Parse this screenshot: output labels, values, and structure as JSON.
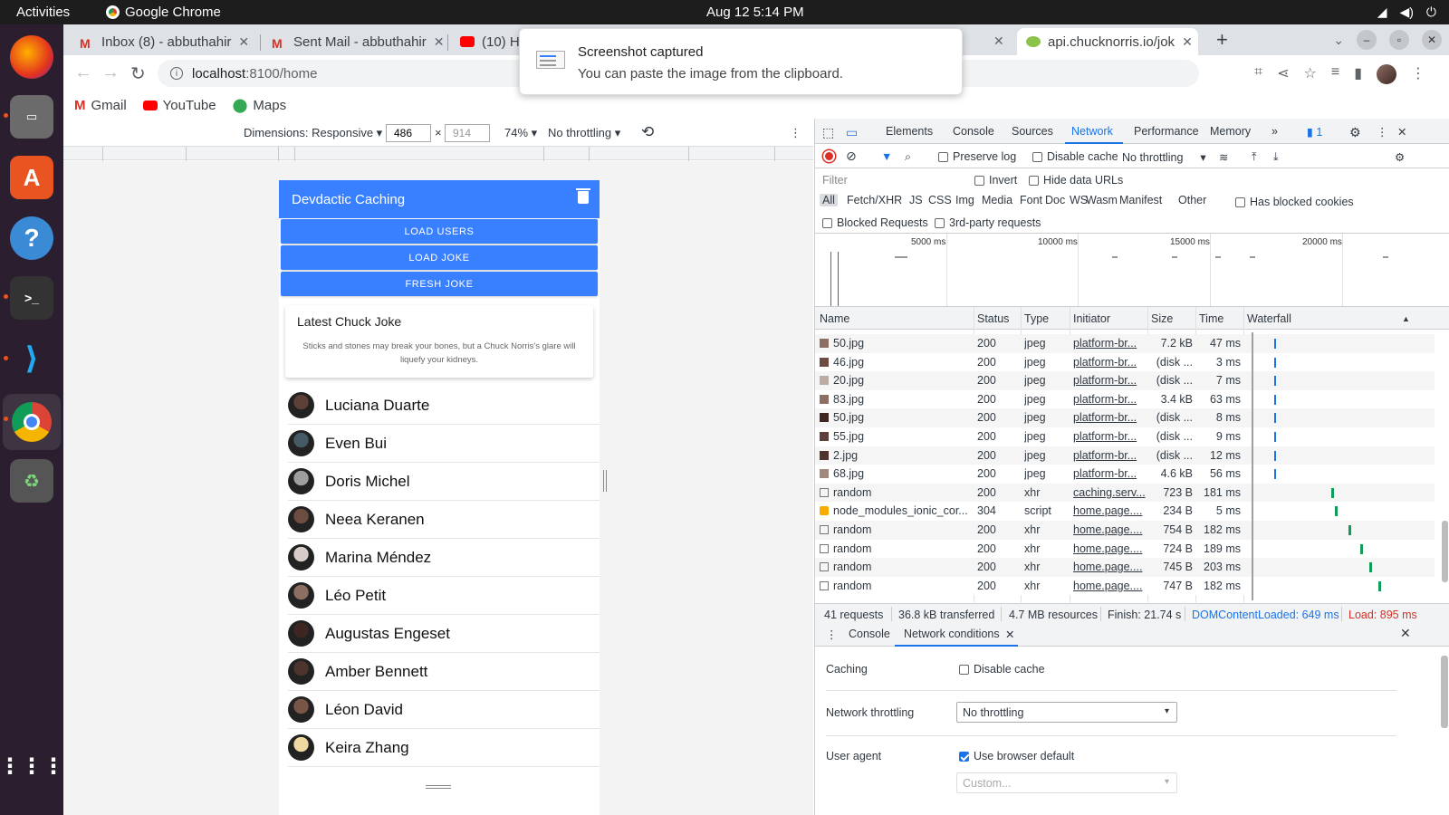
{
  "topbar": {
    "activities": "Activities",
    "app_name": "Google Chrome",
    "clock": "Aug 12  5:14 PM"
  },
  "tabs": [
    {
      "label": "Inbox (8) - abbuthahir",
      "fav": "gmail"
    },
    {
      "label": "Sent Mail - abbuthahir",
      "fav": "gmail"
    },
    {
      "label": "(10) He",
      "fav": "youtube"
    },
    {
      "label": "api.chucknorris.io/jok",
      "fav": "chuck"
    }
  ],
  "omnibox": {
    "host": "localhost",
    "path": ":8100/home"
  },
  "bookmarks": [
    {
      "label": "Gmail",
      "icon": "gmail-icon"
    },
    {
      "label": "YouTube",
      "icon": "youtube-icon"
    },
    {
      "label": "Maps",
      "icon": "maps-icon"
    }
  ],
  "device_bar": {
    "dimensions": "Dimensions: Responsive ▾",
    "width": "486",
    "height": "914",
    "zoom": "74% ▾",
    "throttle": "No throttling ▾"
  },
  "notification": {
    "title": "Screenshot captured",
    "body": "You can paste the image from the clipboard."
  },
  "app": {
    "title": "Devdactic Caching",
    "buttons": [
      "LOAD USERS",
      "LOAD JOKE",
      "FRESH JOKE"
    ],
    "joke_title": "Latest Chuck Joke",
    "joke_text": "Sticks and stones may break your bones, but a Chuck Norris's glare will liquefy your kidneys.",
    "users": [
      {
        "name": "Luciana Duarte",
        "color": "#5d4037"
      },
      {
        "name": "Even Bui",
        "color": "#455a64"
      },
      {
        "name": "Doris Michel",
        "color": "#9e9e9e"
      },
      {
        "name": "Neea Keranen",
        "color": "#6d4c41"
      },
      {
        "name": "Marina Méndez",
        "color": "#d7ccc8"
      },
      {
        "name": "Léo Petit",
        "color": "#8d6e63"
      },
      {
        "name": "Augustas Engeset",
        "color": "#3e2723"
      },
      {
        "name": "Amber Bennett",
        "color": "#4e342e"
      },
      {
        "name": "Léon David",
        "color": "#795548"
      },
      {
        "name": "Keira Zhang",
        "color": "#f0d9a0"
      }
    ]
  },
  "devtools": {
    "tabs": [
      "Elements",
      "Console",
      "Sources",
      "Network",
      "Performance",
      "Memory"
    ],
    "badge": "1",
    "toolbar": {
      "preserve_log": "Preserve log",
      "disable_cache": "Disable cache",
      "throttling": "No throttling"
    },
    "filter_placeholder": "Filter",
    "invert": "Invert",
    "hide_data_urls": "Hide data URLs",
    "type_filters": [
      "All",
      "Fetch/XHR",
      "JS",
      "CSS",
      "Img",
      "Media",
      "Font",
      "Doc",
      "WS",
      "Wasm",
      "Manifest",
      "Other"
    ],
    "has_blocked_cookies": "Has blocked cookies",
    "blocked_requests": "Blocked Requests",
    "third_party": "3rd-party requests",
    "overview_ticks": [
      "5000 ms",
      "10000 ms",
      "15000 ms",
      "20000 ms"
    ],
    "columns": [
      "Name",
      "Status",
      "Type",
      "Initiator",
      "Size",
      "Time",
      "Waterfall"
    ],
    "rows": [
      {
        "name": "50.jpg",
        "status": "200",
        "type": "jpeg",
        "initiator": "platform-br...",
        "size": "7.2 kB",
        "time": "47 ms",
        "icon": "#8d6e63"
      },
      {
        "name": "46.jpg",
        "status": "200",
        "type": "jpeg",
        "initiator": "platform-br...",
        "size": "(disk ...",
        "time": "3 ms",
        "icon": "#6d4c41"
      },
      {
        "name": "20.jpg",
        "status": "200",
        "type": "jpeg",
        "initiator": "platform-br...",
        "size": "(disk ...",
        "time": "7 ms",
        "icon": "#bcaaa4"
      },
      {
        "name": "83.jpg",
        "status": "200",
        "type": "jpeg",
        "initiator": "platform-br...",
        "size": "3.4 kB",
        "time": "63 ms",
        "icon": "#8d6e63"
      },
      {
        "name": "50.jpg",
        "status": "200",
        "type": "jpeg",
        "initiator": "platform-br...",
        "size": "(disk ...",
        "time": "8 ms",
        "icon": "#3e2723"
      },
      {
        "name": "55.jpg",
        "status": "200",
        "type": "jpeg",
        "initiator": "platform-br...",
        "size": "(disk ...",
        "time": "9 ms",
        "icon": "#5d4037"
      },
      {
        "name": "2.jpg",
        "status": "200",
        "type": "jpeg",
        "initiator": "platform-br...",
        "size": "(disk ...",
        "time": "12 ms",
        "icon": "#4e342e"
      },
      {
        "name": "68.jpg",
        "status": "200",
        "type": "jpeg",
        "initiator": "platform-br...",
        "size": "4.6 kB",
        "time": "56 ms",
        "icon": "#a1887f"
      },
      {
        "name": "random",
        "status": "200",
        "type": "xhr",
        "initiator": "caching.serv...",
        "size": "723 B",
        "time": "181 ms",
        "icon": "doc"
      },
      {
        "name": "node_modules_ionic_cor...",
        "status": "304",
        "type": "script",
        "initiator": "home.page....",
        "size": "234 B",
        "time": "5 ms",
        "icon": "script"
      },
      {
        "name": "random",
        "status": "200",
        "type": "xhr",
        "initiator": "home.page....",
        "size": "754 B",
        "time": "182 ms",
        "icon": "doc"
      },
      {
        "name": "random",
        "status": "200",
        "type": "xhr",
        "initiator": "home.page....",
        "size": "724 B",
        "time": "189 ms",
        "icon": "doc"
      },
      {
        "name": "random",
        "status": "200",
        "type": "xhr",
        "initiator": "home.page....",
        "size": "745 B",
        "time": "203 ms",
        "icon": "doc"
      },
      {
        "name": "random",
        "status": "200",
        "type": "xhr",
        "initiator": "home.page....",
        "size": "747 B",
        "time": "182 ms",
        "icon": "doc"
      }
    ],
    "summary": {
      "requests": "41 requests",
      "transferred": "36.8 kB transferred",
      "resources": "4.7 MB resources",
      "finish": "Finish: 21.74 s",
      "dcl": "DOMContentLoaded: 649 ms",
      "load": "Load: 895 ms"
    },
    "drawer_tabs": [
      "Console",
      "Network conditions"
    ],
    "conditions": {
      "caching_label": "Caching",
      "disable_cache": "Disable cache",
      "throttling_label": "Network throttling",
      "throttling_value": "No throttling",
      "ua_label": "User agent",
      "ua_default": "Use browser default",
      "ua_custom": "Custom..."
    }
  }
}
